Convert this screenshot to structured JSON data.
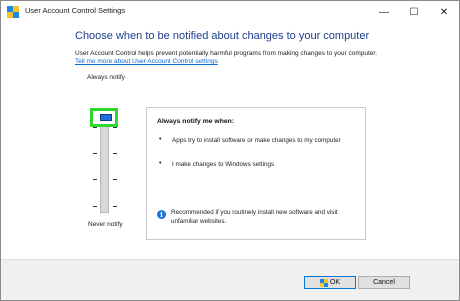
{
  "window": {
    "title": "User Account Control Settings"
  },
  "titlebar": {
    "minimize_glyph": "—",
    "maximize_glyph": "☐",
    "close_glyph": "✕"
  },
  "main": {
    "heading": "Choose when to be notified about changes to your computer",
    "description": "User Account Control helps prevent potentially harmful programs from making changes to your computer.",
    "help_link": "Tell me more about User Account Control settings"
  },
  "slider": {
    "top_label": "Always notify",
    "bottom_label": "Never notify",
    "selected_level": 4,
    "levels": 4
  },
  "panel": {
    "title": "Always notify me when:",
    "bullets": [
      "Apps try to install software or make changes to my computer",
      "I make changes to Windows settings"
    ],
    "info": "Recommended if you routinely install new software and visit unfamiliar websites."
  },
  "buttons": {
    "ok": "OK",
    "cancel": "Cancel"
  },
  "colors": {
    "accent": "#1e6fd9",
    "highlight": "#2cd92c",
    "heading": "#1e3d8c",
    "link": "#0b6bd6"
  }
}
